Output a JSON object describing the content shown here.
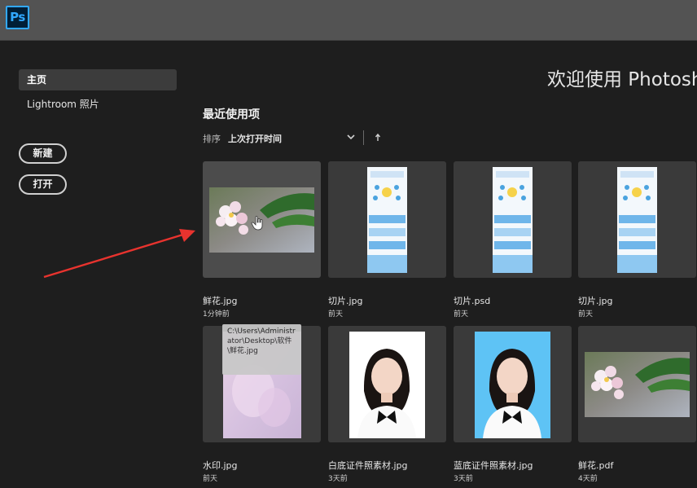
{
  "app": {
    "logo_text": "Ps"
  },
  "sidebar": {
    "items": [
      {
        "label": "主页"
      },
      {
        "label": "Lightroom 照片"
      }
    ],
    "new_button": "新建",
    "open_button": "打开"
  },
  "welcome": {
    "title": "欢迎使用 Photoshop"
  },
  "recent": {
    "title": "最近使用项",
    "sort_label": "排序",
    "sort_value": "上次打开时间",
    "files": [
      {
        "name": "鲜花.jpg",
        "time": "1分钟前"
      },
      {
        "name": "切片.jpg",
        "time": "前天"
      },
      {
        "name": "切片.psd",
        "time": "前天"
      },
      {
        "name": "切片.jpg",
        "time": "前天"
      },
      {
        "name": "水印.jpg",
        "time": "前天"
      },
      {
        "name": "白底证件照素材.jpg",
        "time": "3天前"
      },
      {
        "name": "蓝底证件照素材.jpg",
        "time": "3天前"
      },
      {
        "name": "鲜花.pdf",
        "time": "4天前"
      }
    ]
  },
  "tooltip": {
    "path": "C:\\Users\\Administrator\\Desktop\\软件\\鲜花.jpg"
  },
  "colors": {
    "topbar": "#535353",
    "background": "#1e1e1e",
    "card": "#3a3a3a",
    "annotation_arrow": "#e8332e",
    "id_photo_blue": "#5ec3f5"
  }
}
